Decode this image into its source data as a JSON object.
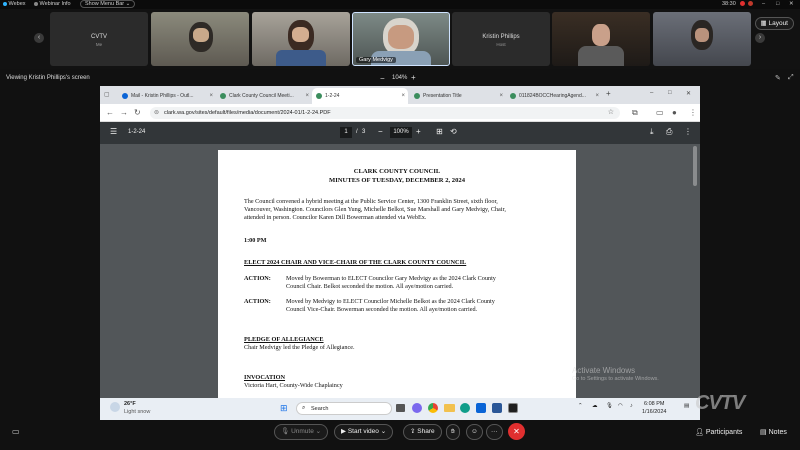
{
  "webex": {
    "app_name": "Webex",
    "webinar_info": "Webinar Info",
    "show_menu_bar": "Show Menu Bar",
    "timer": "38:30"
  },
  "participants": [
    {
      "name": "CVTV",
      "sub": "Me"
    },
    {
      "name": "",
      "sub": ""
    },
    {
      "name": "",
      "sub": ""
    },
    {
      "name": "Gary Medvigy",
      "sub": ""
    },
    {
      "name": "Kristin Phillips",
      "sub": "Host"
    },
    {
      "name": "",
      "sub": ""
    },
    {
      "name": "",
      "sub": ""
    }
  ],
  "layout_label": "Layout",
  "viewing_label": "Viewing Kristin Phillips's screen",
  "zoom": {
    "minus": "−",
    "value": "104%",
    "plus": "+"
  },
  "browser": {
    "tabs": [
      {
        "label": "Mail - Kristin Phillips - Outl..."
      },
      {
        "label": "Clark County Council Meeti..."
      },
      {
        "label": "1-2-24"
      },
      {
        "label": "Presentation Title"
      },
      {
        "label": "011824BOCCHearingAgend..."
      }
    ],
    "new_tab": "+",
    "url": "clark.wa.gov/sites/default/files/media/document/2024-01/1-2-24.PDF"
  },
  "pdf": {
    "menu_icon": "☰",
    "title": "1-2-24",
    "page_current": "1",
    "page_sep": "/",
    "page_total": "3",
    "zoom": "100%",
    "zoom_minus": "−",
    "zoom_plus": "+"
  },
  "doc": {
    "title1": "CLARK COUNTY COUNCIL",
    "title2": "MINUTES OF TUESDAY, DECEMBER 2, 2024",
    "intro_lines": [
      "The Council convened a hybrid meeting at the Public Service Center, 1300 Franklin Street, sixth floor,",
      "Vancouver, Washington. Councilors Glen Yung, Michelle Belkot, Sue Marshall and Gary Medvigy, Chair,",
      "attended in person. Councilor Karen Dill Bowerman attended via WebEx."
    ],
    "time": "1:00 PM",
    "heading1": "ELECT 2024 CHAIR AND VICE-CHAIR OF THE CLARK COUNTY COUNCIL",
    "action_label": "ACTION:",
    "action1": [
      "Moved by Bowerman to ELECT Councilor Gary Medvigy as the 2024 Clark County",
      "Council Chair. Belkot seconded the motion. All aye/motion carried."
    ],
    "action2": [
      "Moved by Medvigy to ELECT Councilor Michelle Belkot as the 2024 Clark County",
      "Council Vice-Chair. Bowerman seconded the motion. All aye/motion carried."
    ],
    "heading2": "PLEDGE OF ALLEGIANCE",
    "pledge": "Chair Medvigy led the Pledge of Allegiance.",
    "heading3": "INVOCATION",
    "invocation": "Victoria Hart, County-Wide Chaplaincy"
  },
  "watermark": {
    "line1": "Activate Windows",
    "line2": "Go to Settings to activate Windows."
  },
  "taskbar": {
    "weather_temp": "26°F",
    "weather_desc": "Light snow",
    "search": "Search",
    "time": "6:08 PM",
    "date": "1/16/2024"
  },
  "cvtv_logo": "CVTV",
  "controls": {
    "unmute": "Unmute",
    "start_video": "Start video",
    "share": "Share",
    "more": "···",
    "participants": "Participants",
    "notes": "Notes"
  },
  "colors": {
    "leave": "#e02f2f",
    "chrome_tabbar": "#dee1e6",
    "pdf_toolbar": "#323639",
    "pdf_bg": "#525659"
  }
}
